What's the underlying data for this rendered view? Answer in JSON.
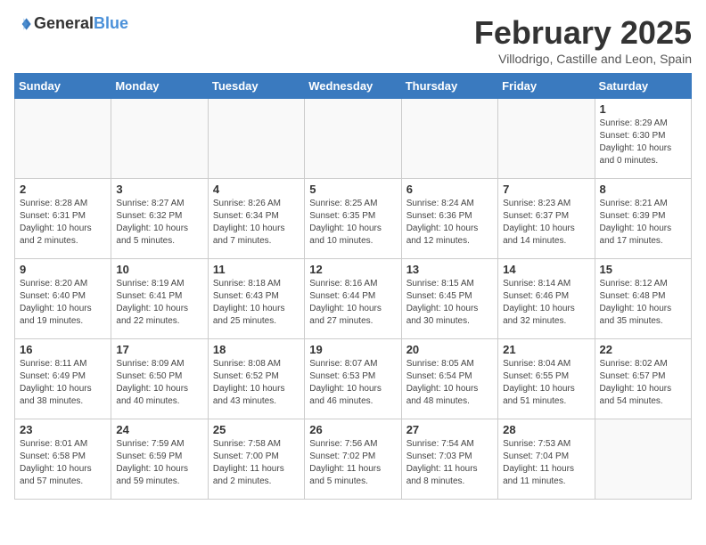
{
  "header": {
    "logo_general": "General",
    "logo_blue": "Blue",
    "month_year": "February 2025",
    "location": "Villodrigo, Castille and Leon, Spain"
  },
  "days_of_week": [
    "Sunday",
    "Monday",
    "Tuesday",
    "Wednesday",
    "Thursday",
    "Friday",
    "Saturday"
  ],
  "weeks": [
    [
      {
        "num": "",
        "info": ""
      },
      {
        "num": "",
        "info": ""
      },
      {
        "num": "",
        "info": ""
      },
      {
        "num": "",
        "info": ""
      },
      {
        "num": "",
        "info": ""
      },
      {
        "num": "",
        "info": ""
      },
      {
        "num": "1",
        "info": "Sunrise: 8:29 AM\nSunset: 6:30 PM\nDaylight: 10 hours\nand 0 minutes."
      }
    ],
    [
      {
        "num": "2",
        "info": "Sunrise: 8:28 AM\nSunset: 6:31 PM\nDaylight: 10 hours\nand 2 minutes."
      },
      {
        "num": "3",
        "info": "Sunrise: 8:27 AM\nSunset: 6:32 PM\nDaylight: 10 hours\nand 5 minutes."
      },
      {
        "num": "4",
        "info": "Sunrise: 8:26 AM\nSunset: 6:34 PM\nDaylight: 10 hours\nand 7 minutes."
      },
      {
        "num": "5",
        "info": "Sunrise: 8:25 AM\nSunset: 6:35 PM\nDaylight: 10 hours\nand 10 minutes."
      },
      {
        "num": "6",
        "info": "Sunrise: 8:24 AM\nSunset: 6:36 PM\nDaylight: 10 hours\nand 12 minutes."
      },
      {
        "num": "7",
        "info": "Sunrise: 8:23 AM\nSunset: 6:37 PM\nDaylight: 10 hours\nand 14 minutes."
      },
      {
        "num": "8",
        "info": "Sunrise: 8:21 AM\nSunset: 6:39 PM\nDaylight: 10 hours\nand 17 minutes."
      }
    ],
    [
      {
        "num": "9",
        "info": "Sunrise: 8:20 AM\nSunset: 6:40 PM\nDaylight: 10 hours\nand 19 minutes."
      },
      {
        "num": "10",
        "info": "Sunrise: 8:19 AM\nSunset: 6:41 PM\nDaylight: 10 hours\nand 22 minutes."
      },
      {
        "num": "11",
        "info": "Sunrise: 8:18 AM\nSunset: 6:43 PM\nDaylight: 10 hours\nand 25 minutes."
      },
      {
        "num": "12",
        "info": "Sunrise: 8:16 AM\nSunset: 6:44 PM\nDaylight: 10 hours\nand 27 minutes."
      },
      {
        "num": "13",
        "info": "Sunrise: 8:15 AM\nSunset: 6:45 PM\nDaylight: 10 hours\nand 30 minutes."
      },
      {
        "num": "14",
        "info": "Sunrise: 8:14 AM\nSunset: 6:46 PM\nDaylight: 10 hours\nand 32 minutes."
      },
      {
        "num": "15",
        "info": "Sunrise: 8:12 AM\nSunset: 6:48 PM\nDaylight: 10 hours\nand 35 minutes."
      }
    ],
    [
      {
        "num": "16",
        "info": "Sunrise: 8:11 AM\nSunset: 6:49 PM\nDaylight: 10 hours\nand 38 minutes."
      },
      {
        "num": "17",
        "info": "Sunrise: 8:09 AM\nSunset: 6:50 PM\nDaylight: 10 hours\nand 40 minutes."
      },
      {
        "num": "18",
        "info": "Sunrise: 8:08 AM\nSunset: 6:52 PM\nDaylight: 10 hours\nand 43 minutes."
      },
      {
        "num": "19",
        "info": "Sunrise: 8:07 AM\nSunset: 6:53 PM\nDaylight: 10 hours\nand 46 minutes."
      },
      {
        "num": "20",
        "info": "Sunrise: 8:05 AM\nSunset: 6:54 PM\nDaylight: 10 hours\nand 48 minutes."
      },
      {
        "num": "21",
        "info": "Sunrise: 8:04 AM\nSunset: 6:55 PM\nDaylight: 10 hours\nand 51 minutes."
      },
      {
        "num": "22",
        "info": "Sunrise: 8:02 AM\nSunset: 6:57 PM\nDaylight: 10 hours\nand 54 minutes."
      }
    ],
    [
      {
        "num": "23",
        "info": "Sunrise: 8:01 AM\nSunset: 6:58 PM\nDaylight: 10 hours\nand 57 minutes."
      },
      {
        "num": "24",
        "info": "Sunrise: 7:59 AM\nSunset: 6:59 PM\nDaylight: 10 hours\nand 59 minutes."
      },
      {
        "num": "25",
        "info": "Sunrise: 7:58 AM\nSunset: 7:00 PM\nDaylight: 11 hours\nand 2 minutes."
      },
      {
        "num": "26",
        "info": "Sunrise: 7:56 AM\nSunset: 7:02 PM\nDaylight: 11 hours\nand 5 minutes."
      },
      {
        "num": "27",
        "info": "Sunrise: 7:54 AM\nSunset: 7:03 PM\nDaylight: 11 hours\nand 8 minutes."
      },
      {
        "num": "28",
        "info": "Sunrise: 7:53 AM\nSunset: 7:04 PM\nDaylight: 11 hours\nand 11 minutes."
      },
      {
        "num": "",
        "info": ""
      }
    ]
  ]
}
